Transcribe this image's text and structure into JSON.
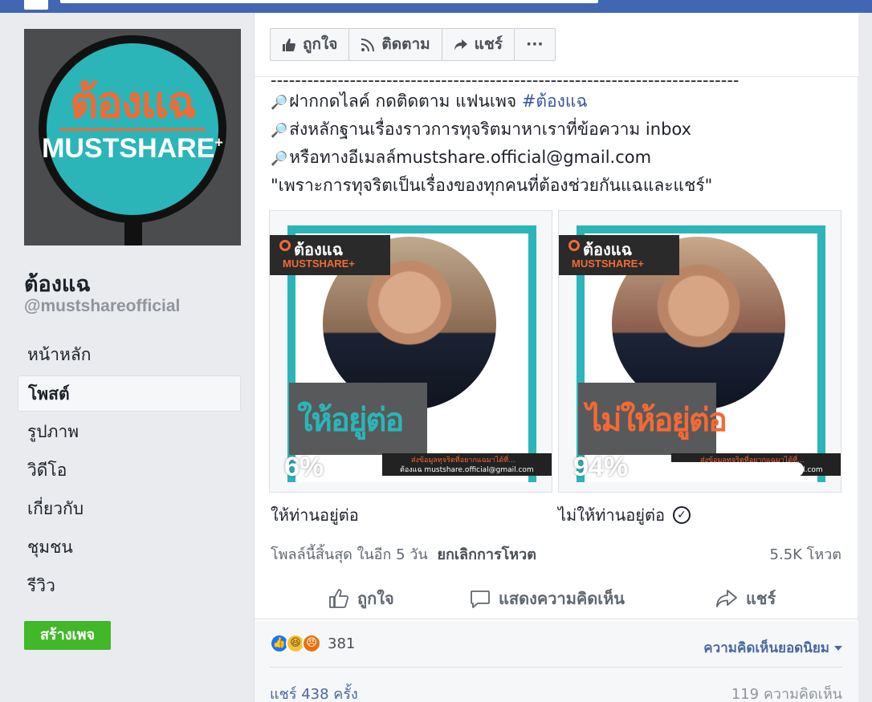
{
  "page": {
    "name": "ต้องแฉ",
    "handle": "@mustshareofficial",
    "logo_th": "ต้องแฉ",
    "logo_en": "MUSTSHARE",
    "logo_plus": "+"
  },
  "nav": [
    {
      "label": "หน้าหลัก",
      "active": false
    },
    {
      "label": "โพสต์",
      "active": true
    },
    {
      "label": "รูปภาพ",
      "active": false
    },
    {
      "label": "วิดีโอ",
      "active": false
    },
    {
      "label": "เกี่ยวกับ",
      "active": false
    },
    {
      "label": "ชุมชน",
      "active": false
    },
    {
      "label": "รีวิว",
      "active": false
    }
  ],
  "create_page": "สร้างเพจ",
  "toolbar": {
    "like": "ถูกใจ",
    "follow": "ติดตาม",
    "share": "แชร์",
    "more": "···"
  },
  "post": {
    "dashes": "-----------------------------------------------------------------------------",
    "line1_prefix": "ฝากกดไลค์ กดติดตาม แฟนเพจ ",
    "line1_hashtag": "#ต้องแฉ",
    "line2": "ส่งหลักฐานเรื่องราวการทุจริตมาหาเราที่ข้อความ inbox",
    "line3": "หรือทางอีเมลล์mustshare.official@gmail.com",
    "line4": "\"เพราะการทุจริตเป็นเรื่องของทุกคนที่ต้องช่วยกันแฉและแชร์\""
  },
  "poll": {
    "options": [
      {
        "label": "ให้ท่านอยู่ต่อ",
        "image_text": "ให้อยู่ต่อ",
        "percent": 6,
        "percent_text": "6%",
        "voted": false
      },
      {
        "label": "ไม่ให้ท่านอยู่ต่อ",
        "image_text": "ไม่ให้อยู่ต่อ",
        "percent": 94,
        "percent_text": "94%",
        "voted": true
      }
    ],
    "badge_th": "ต้องแฉ",
    "badge_en": "MUSTSHARE+",
    "strip_line1": "ส่งข้อมูลทุจริตที่อยากแฉมาได้ที่...",
    "strip_line2": "ต้องแฉ  mustshare.official@gmail.com",
    "ends_text": "โพลล์นี้สิ้นสุด ในอีก 5 วัน",
    "cancel_vote": "ยกเลิกการโหวต",
    "votes": "5.5K โหวต"
  },
  "actions": {
    "like": "ถูกใจ",
    "comment": "แสดงความคิดเห็น",
    "share": "แชร์"
  },
  "feedback": {
    "reaction_count": "381",
    "top_comments": "ความคิดเห็นยอดนิยม",
    "shares": "แชร์ 438 ครั้ง",
    "comments": "119 ความคิดเห็น"
  },
  "colors": {
    "facebook_blue": "#4267b2",
    "teal": "#2bb5b8",
    "orange": "#f26a35",
    "create_green": "#42b72a"
  }
}
